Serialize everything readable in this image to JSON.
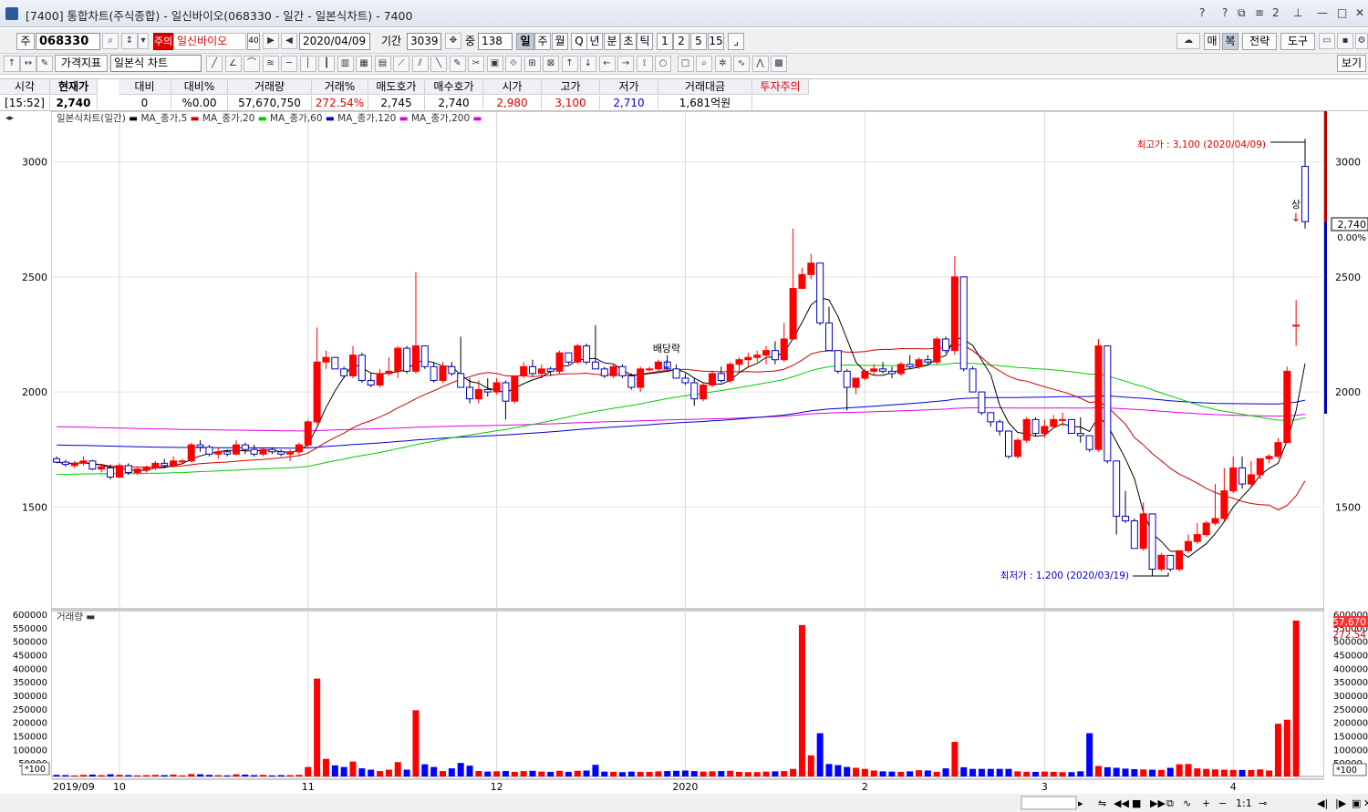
{
  "title": "[7400] 통합차트(주식종합) - 일신바이오(068330 - 일간 - 일본식차트) - 7400",
  "toolbar": {
    "market": "주",
    "code": "068330",
    "warning": "주의",
    "name": "일신바이오",
    "count_box": "40",
    "date": "2020/04/09",
    "period_label": "기간",
    "period_value": "3039",
    "amount_label": "중",
    "amount_value": "138",
    "intervals": [
      "일",
      "주",
      "월",
      "Q",
      "년",
      "분",
      "초",
      "틱",
      "1",
      "2",
      "5",
      "15"
    ],
    "active_interval": "일",
    "right_buttons": [
      "매",
      "복",
      "전략",
      "도구"
    ]
  },
  "toolbar2": {
    "price_indicator": "가격지표",
    "chart_type": "일본식 차트",
    "view_button": "보기"
  },
  "quote": {
    "time_label": "시각",
    "time": "[15:52]",
    "headers": [
      "현재가",
      "대비",
      "대비%",
      "거래량",
      "거래%",
      "매도호가",
      "매수호가",
      "시가",
      "고가",
      "저가",
      "거래대금"
    ],
    "values": [
      "2,740",
      "0",
      "%0.00",
      "57,670,750",
      "272.54%",
      "2,745",
      "2,740",
      "2,980",
      "3,100",
      "2,710",
      "1,681억원"
    ],
    "investor_warning": "투자주의"
  },
  "colors": {
    "up": "#ff0000",
    "down": "#0000ff",
    "ma5": "#000000",
    "ma20": "#cc0000",
    "ma60": "#00cc00",
    "ma120": "#0000cc",
    "ma200": "#e000e0"
  },
  "chart_data": {
    "type": "candlestick",
    "title": "일본식차트(일간)",
    "legend": [
      "MA_종가,5",
      "MA_종가,20",
      "MA_종가,60",
      "MA_종가,120",
      "MA_종가,200"
    ],
    "y_ticks": [
      3000,
      2500,
      2000,
      1500
    ],
    "ylim": [
      1150,
      3200
    ],
    "x_ticks": [
      "2019/09",
      "10",
      "11",
      "12",
      "2020",
      "2",
      "3",
      "4"
    ],
    "x_tick_index": [
      0,
      7,
      28,
      49,
      70,
      90,
      110,
      131
    ],
    "annotations": {
      "high": "최고가 : 3,100 (2020/04/09)",
      "low": "최저가 : 1,200 (2020/03/19)",
      "dividend": "배당락",
      "limit_up": "상"
    },
    "price_right": "2,740",
    "change_right": "0.00%",
    "candles": [
      [
        1710,
        1720,
        1690,
        1695
      ],
      [
        1695,
        1705,
        1675,
        1685
      ],
      [
        1680,
        1700,
        1670,
        1690
      ],
      [
        1690,
        1720,
        1680,
        1700
      ],
      [
        1700,
        1705,
        1660,
        1665
      ],
      [
        1665,
        1680,
        1650,
        1675
      ],
      [
        1670,
        1685,
        1620,
        1630
      ],
      [
        1630,
        1690,
        1625,
        1680
      ],
      [
        1680,
        1690,
        1640,
        1650
      ],
      [
        1650,
        1670,
        1640,
        1665
      ],
      [
        1660,
        1680,
        1650,
        1670
      ],
      [
        1670,
        1700,
        1660,
        1690
      ],
      [
        1690,
        1710,
        1670,
        1680
      ],
      [
        1680,
        1720,
        1670,
        1700
      ],
      [
        1700,
        1710,
        1690,
        1700
      ],
      [
        1700,
        1780,
        1695,
        1770
      ],
      [
        1770,
        1790,
        1740,
        1760
      ],
      [
        1760,
        1770,
        1720,
        1730
      ],
      [
        1730,
        1760,
        1710,
        1740
      ],
      [
        1740,
        1750,
        1720,
        1730
      ],
      [
        1730,
        1790,
        1725,
        1770
      ],
      [
        1770,
        1780,
        1730,
        1750
      ],
      [
        1750,
        1770,
        1720,
        1730
      ],
      [
        1730,
        1760,
        1720,
        1750
      ],
      [
        1750,
        1760,
        1730,
        1740
      ],
      [
        1740,
        1750,
        1720,
        1730
      ],
      [
        1730,
        1750,
        1700,
        1740
      ],
      [
        1740,
        1780,
        1720,
        1770
      ],
      [
        1770,
        1880,
        1760,
        1870
      ],
      [
        1870,
        2280,
        1860,
        2130
      ],
      [
        2130,
        2180,
        2100,
        2150
      ],
      [
        2150,
        2150,
        2100,
        2100
      ],
      [
        2100,
        2110,
        2060,
        2070
      ],
      [
        2070,
        2200,
        2060,
        2160
      ],
      [
        2160,
        2170,
        2040,
        2050
      ],
      [
        2050,
        2080,
        2020,
        2030
      ],
      [
        2030,
        2100,
        2020,
        2080
      ],
      [
        2080,
        2150,
        2070,
        2090
      ],
      [
        2090,
        2200,
        2060,
        2190
      ],
      [
        2190,
        2200,
        2080,
        2090
      ],
      [
        2090,
        2520,
        2080,
        2200
      ],
      [
        2200,
        2200,
        2100,
        2110
      ],
      [
        2110,
        2130,
        2040,
        2050
      ],
      [
        2050,
        2130,
        2040,
        2110
      ],
      [
        2110,
        2130,
        2070,
        2080
      ],
      [
        2080,
        2240,
        2020,
        2020
      ],
      [
        2020,
        2060,
        1950,
        1970
      ],
      [
        1970,
        2050,
        1950,
        2010
      ],
      [
        2010,
        2060,
        1980,
        2000
      ],
      [
        2000,
        2060,
        1990,
        2040
      ],
      [
        2040,
        2050,
        1880,
        1960
      ],
      [
        1960,
        2070,
        1950,
        2070
      ],
      [
        2070,
        2130,
        2060,
        2110
      ],
      [
        2110,
        2140,
        2070,
        2080
      ],
      [
        2080,
        2120,
        2060,
        2100
      ],
      [
        2100,
        2110,
        2070,
        2090
      ],
      [
        2090,
        2180,
        2080,
        2170
      ],
      [
        2170,
        2170,
        2120,
        2130
      ],
      [
        2130,
        2210,
        2120,
        2200
      ],
      [
        2200,
        2210,
        2120,
        2130
      ],
      [
        2130,
        2290,
        2110,
        2100
      ],
      [
        2100,
        2110,
        2060,
        2070
      ],
      [
        2070,
        2120,
        2060,
        2110
      ],
      [
        2110,
        2120,
        2060,
        2070
      ],
      [
        2070,
        2080,
        2010,
        2020
      ],
      [
        2020,
        2110,
        2000,
        2100
      ],
      [
        2100,
        2110,
        2090,
        2100
      ],
      [
        2100,
        2140,
        2090,
        2130
      ],
      [
        2130,
        2160,
        2100,
        2100
      ],
      [
        2100,
        2120,
        2060,
        2060
      ],
      [
        2060,
        2080,
        2030,
        2040
      ],
      [
        2040,
        2060,
        1940,
        1970
      ],
      [
        1970,
        2040,
        1960,
        2030
      ],
      [
        2030,
        2090,
        2020,
        2080
      ],
      [
        2080,
        2110,
        2040,
        2050
      ],
      [
        2050,
        2130,
        2040,
        2120
      ],
      [
        2120,
        2150,
        2090,
        2140
      ],
      [
        2140,
        2170,
        2110,
        2150
      ],
      [
        2150,
        2180,
        2130,
        2160
      ],
      [
        2160,
        2200,
        2120,
        2180
      ],
      [
        2180,
        2220,
        2120,
        2140
      ],
      [
        2140,
        2300,
        2130,
        2230
      ],
      [
        2230,
        2710,
        2230,
        2450
      ],
      [
        2450,
        2540,
        2450,
        2510
      ],
      [
        2510,
        2600,
        2490,
        2560
      ],
      [
        2560,
        2470,
        2290,
        2300
      ],
      [
        2300,
        2370,
        2180,
        2180
      ],
      [
        2180,
        2150,
        2080,
        2090
      ],
      [
        2090,
        2100,
        1920,
        2020
      ],
      [
        2020,
        2060,
        1990,
        2060
      ],
      [
        2060,
        2100,
        2050,
        2090
      ],
      [
        2090,
        2120,
        2070,
        2100
      ],
      [
        2100,
        2130,
        2080,
        2090
      ],
      [
        2090,
        2110,
        2060,
        2080
      ],
      [
        2080,
        2130,
        2070,
        2120
      ],
      [
        2120,
        2160,
        2100,
        2110
      ],
      [
        2110,
        2150,
        2100,
        2140
      ],
      [
        2140,
        2160,
        2120,
        2130
      ],
      [
        2130,
        2240,
        2120,
        2230
      ],
      [
        2230,
        2240,
        2170,
        2180
      ],
      [
        2180,
        2590,
        2160,
        2500
      ],
      [
        2500,
        2230,
        2090,
        2100
      ],
      [
        2100,
        2110,
        2000,
        2000
      ],
      [
        2000,
        1980,
        1900,
        1910
      ],
      [
        1910,
        1900,
        1850,
        1870
      ],
      [
        1870,
        1880,
        1810,
        1830
      ],
      [
        1830,
        1800,
        1710,
        1720
      ],
      [
        1720,
        1800,
        1710,
        1790
      ],
      [
        1790,
        1890,
        1780,
        1880
      ],
      [
        1880,
        1890,
        1810,
        1820
      ],
      [
        1820,
        1880,
        1800,
        1850
      ],
      [
        1850,
        1900,
        1840,
        1880
      ],
      [
        1880,
        1910,
        1850,
        1880
      ],
      [
        1880,
        1880,
        1820,
        1820
      ],
      [
        1820,
        1890,
        1780,
        1810
      ],
      [
        1810,
        1810,
        1740,
        1750
      ],
      [
        1750,
        2230,
        1740,
        2200
      ],
      [
        2200,
        1870,
        1690,
        1700
      ],
      [
        1700,
        1560,
        1380,
        1460
      ],
      [
        1460,
        1570,
        1430,
        1440
      ],
      [
        1440,
        1450,
        1320,
        1320
      ],
      [
        1320,
        1520,
        1310,
        1470
      ],
      [
        1470,
        1450,
        1200,
        1230
      ],
      [
        1230,
        1300,
        1220,
        1290
      ],
      [
        1290,
        1270,
        1220,
        1230
      ],
      [
        1230,
        1310,
        1220,
        1310
      ],
      [
        1310,
        1380,
        1300,
        1350
      ],
      [
        1350,
        1430,
        1340,
        1380
      ],
      [
        1380,
        1440,
        1370,
        1430
      ],
      [
        1430,
        1600,
        1420,
        1450
      ],
      [
        1450,
        1670,
        1440,
        1570
      ],
      [
        1570,
        1720,
        1560,
        1670
      ],
      [
        1670,
        1720,
        1580,
        1600
      ],
      [
        1600,
        1700,
        1590,
        1640
      ],
      [
        1640,
        1700,
        1620,
        1710
      ],
      [
        1710,
        1730,
        1690,
        1720
      ],
      [
        1720,
        1800,
        1710,
        1780
      ],
      [
        1780,
        2110,
        1780,
        2090
      ],
      [
        2290,
        2400,
        2200,
        2290
      ],
      [
        2980,
        3100,
        2710,
        2740
      ]
    ],
    "volume_ticks": [
      600000,
      550000,
      500000,
      450000,
      400000,
      350000,
      300000,
      250000,
      200000,
      150000,
      100000,
      50000
    ],
    "volume_label": "거래량",
    "volume_unit": "*100",
    "volume_right": "57,670",
    "volume_pct_right": "272.54",
    "volume": [
      6000,
      5000,
      4000,
      6000,
      7000,
      5000,
      8000,
      6000,
      5000,
      4000,
      5000,
      6000,
      5000,
      7000,
      4000,
      9000,
      8000,
      6000,
      5000,
      4000,
      8000,
      7000,
      5000,
      6000,
      4000,
      5000,
      5000,
      6000,
      35000,
      362000,
      65000,
      41000,
      35000,
      55000,
      30000,
      25000,
      20000,
      25000,
      53000,
      25000,
      245000,
      45000,
      35000,
      20000,
      30000,
      50000,
      40000,
      20000,
      18000,
      19000,
      20000,
      17000,
      20000,
      21000,
      18000,
      17000,
      21000,
      17000,
      21000,
      22000,
      43000,
      18000,
      17000,
      16000,
      18000,
      17000,
      17000,
      19000,
      20000,
      21000,
      22000,
      20000,
      18000,
      19000,
      20000,
      21000,
      17000,
      16000,
      16000,
      18000,
      19000,
      20000,
      28000,
      560000,
      78000,
      160000,
      46000,
      42000,
      35000,
      32000,
      28000,
      22000,
      19000,
      18000,
      17000,
      19000,
      23000,
      22000,
      17000,
      30000,
      128000,
      34000,
      28000,
      28000,
      28000,
      28000,
      28000,
      19000,
      17000,
      17000,
      18000,
      17000,
      16000,
      16000,
      19000,
      160000,
      39000,
      34000,
      32000,
      29000,
      27000,
      26000,
      25000,
      24000,
      32000,
      45000,
      46000,
      30000,
      28000,
      26000,
      25000,
      24000,
      24000,
      24000,
      26000,
      22000,
      195000,
      210000,
      576707
    ]
  }
}
